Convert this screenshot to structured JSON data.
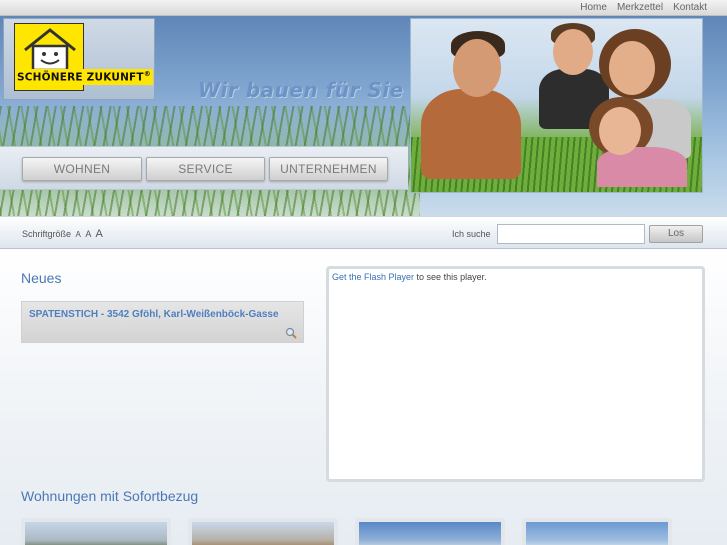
{
  "topnav": {
    "home": "Home",
    "merkzettel": "Merkzettel",
    "kontakt": "Kontakt"
  },
  "logo": {
    "text": "SCHÖNERE ZUKUNFT",
    "reg": "®"
  },
  "slogan": "Wir bauen für Sie",
  "mainnav": {
    "wohnen": "WOHNEN",
    "service": "SERVICE",
    "unternehmen": "UNTERNEHMEN"
  },
  "fontsize": {
    "label": "Schriftgröße",
    "small": "A",
    "medium": "A",
    "large": "A"
  },
  "search": {
    "label": "Ich suche",
    "value": "",
    "placeholder": "",
    "button": "Los"
  },
  "news": {
    "title": "Neues",
    "items": [
      {
        "label": "SPATENSTICH - 3542 Gföhl, Karl-Weißenböck-Gasse"
      }
    ]
  },
  "flash": {
    "link": "Get the Flash Player",
    "text": " to see this player."
  },
  "apartments": {
    "title": "Wohnungen mit Sofortbezug"
  },
  "colors": {
    "accent": "#4a78b5",
    "logo_yellow": "#ffe600",
    "link": "#3a72b8"
  },
  "icons": {
    "news_detail": "magnifier-icon",
    "logo": "smiling-house-icon"
  }
}
